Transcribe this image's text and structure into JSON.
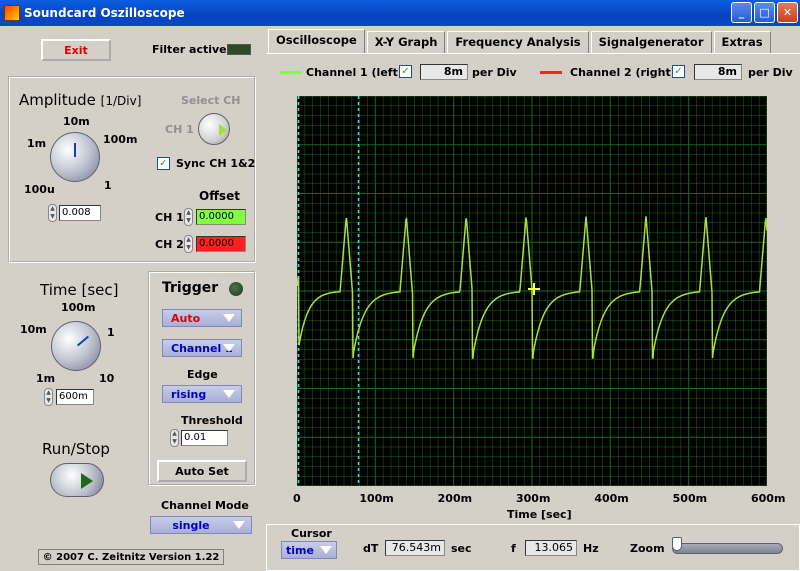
{
  "window": {
    "title": "Soundcard Oszilloscope",
    "buttons": [
      "minimize",
      "maximize",
      "close"
    ]
  },
  "controls": {
    "exit_label": "Exit",
    "filter_label": "Filter active",
    "amplitude": {
      "title": "Amplitude",
      "unit": "[1/Div]",
      "knob_labels": [
        "10m",
        "1m",
        "100m",
        "100u",
        "1"
      ],
      "value": "0.008"
    },
    "select_ch": {
      "title": "Select CH",
      "ch_label": "CH 1"
    },
    "sync_label": "Sync CH 1&2",
    "sync_checked": true,
    "offset": {
      "title": "Offset",
      "ch1_label": "CH 1",
      "ch1_value": "0.0000",
      "ch2_label": "CH 2",
      "ch2_value": "0.0000"
    },
    "time": {
      "title": "Time [sec]",
      "knob_labels": [
        "100m",
        "10m",
        "1",
        "1m",
        "10"
      ],
      "value": "600m"
    },
    "trigger": {
      "title": "Trigger",
      "mode": "Auto",
      "channel": "Channel 1",
      "edge_label": "Edge",
      "edge": "rising",
      "threshold_label": "Threshold",
      "threshold": "0.01",
      "autoset_label": "Auto Set"
    },
    "run_stop_label": "Run/Stop",
    "channel_mode_label": "Channel Mode",
    "channel_mode": "single",
    "copyright": "© 2007   C. Zeitnitz Version 1.22"
  },
  "tabs": [
    {
      "label": "Oscilloscope",
      "active": true
    },
    {
      "label": "X-Y Graph",
      "active": false
    },
    {
      "label": "Frequency Analysis",
      "active": false
    },
    {
      "label": "Signalgenerator",
      "active": false
    },
    {
      "label": "Extras",
      "active": false
    }
  ],
  "channels": {
    "ch1": {
      "label": "Channel 1 (left)",
      "checked": true,
      "value": "8m",
      "unit": "per Div",
      "color": "#80ff40"
    },
    "ch2": {
      "label": "Channel 2 (right)",
      "checked": true,
      "value": "8m",
      "unit": "per Div",
      "color": "#ff2020"
    }
  },
  "plot": {
    "xlabel": "Time [sec]",
    "x_ticks": [
      "0",
      "100m",
      "200m",
      "300m",
      "400m",
      "500m",
      "600m"
    ],
    "xlim": [
      0,
      0.6
    ],
    "cursor_positions_sec": [
      0.002,
      0.0785
    ],
    "period_sec": 0.0765,
    "first_spike_sec": 0.063,
    "trace_color": "#a8e040",
    "grid_color": "#1a6a1a"
  },
  "footer": {
    "cursor_label": "Cursor",
    "cursor_mode": "time",
    "dt_label": "dT",
    "dt_value": "76.543m",
    "dt_unit": "sec",
    "f_label": "f",
    "f_value": "13.065",
    "f_unit": "Hz",
    "zoom_label": "Zoom",
    "zoom_level": 0.0
  }
}
